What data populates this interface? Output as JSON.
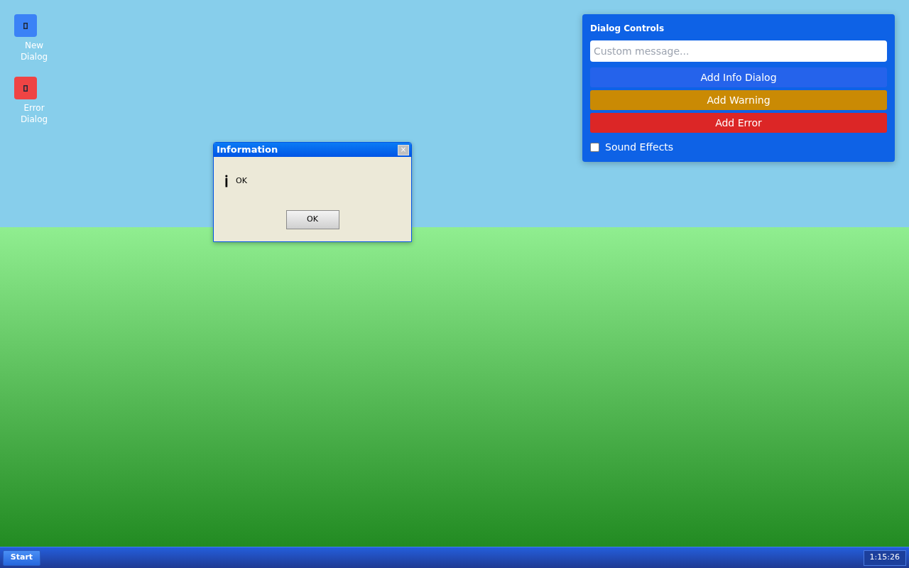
{
  "desktop_icons": [
    {
      "label": "New Dialog",
      "color": "#3b82f6"
    },
    {
      "label": "Error Dialog",
      "color": "#ef4444"
    }
  ],
  "dialog": {
    "title": "Information",
    "close": "×",
    "icon": "ℹ",
    "message": "OK",
    "buttons": [
      "OK"
    ]
  },
  "control_panel": {
    "title": "Dialog Controls",
    "message_field": {
      "placeholder": "Custom message..."
    },
    "buttons": [
      {
        "label": "Add Info Dialog",
        "color": "#2563eb"
      },
      {
        "label": "Add Warning",
        "color": "#ca8a04"
      },
      {
        "label": "Add Error",
        "color": "#dc2626"
      }
    ],
    "sound_effects": {
      "label": "Sound Effects",
      "checked": false
    }
  },
  "taskbar": {
    "start": "Start",
    "clock": "1:15:26"
  }
}
